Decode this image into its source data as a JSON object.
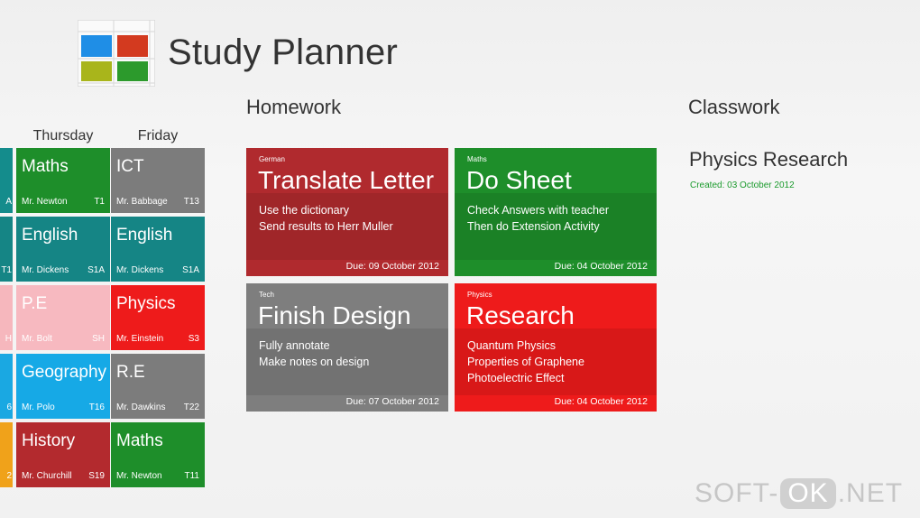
{
  "app": {
    "title": "Study Planner"
  },
  "logo": {
    "colors": [
      "#1f8ee6",
      "#d33a1f",
      "#a9b51b",
      "#2c9a2c"
    ]
  },
  "sections": {
    "homework": "Homework",
    "classwork": "Classwork"
  },
  "timetable": {
    "days": [
      "Thursday",
      "Friday"
    ],
    "partial_rooms": [
      "A",
      "T1",
      "H",
      "6",
      "2"
    ],
    "partial_colors": [
      "#148c8c",
      "#158585",
      "#f6b7bd",
      "#1aa8e2",
      "#f0a21a"
    ],
    "thursday": [
      {
        "subject": "Maths",
        "teacher": "Mr. Newton",
        "room": "T1",
        "color": "#1e8e2a"
      },
      {
        "subject": "English",
        "teacher": "Mr. Dickens",
        "room": "S1A",
        "color": "#158585"
      },
      {
        "subject": "P.E",
        "teacher": "Mr. Bolt",
        "room": "SH",
        "color": "#f7b9c0"
      },
      {
        "subject": "Geography",
        "teacher": "Mr. Polo",
        "room": "T16",
        "color": "#16a9e6"
      },
      {
        "subject": "History",
        "teacher": "Mr. Churchill",
        "room": "S19",
        "color": "#b32a2e"
      }
    ],
    "friday": [
      {
        "subject": "ICT",
        "teacher": "Mr. Babbage",
        "room": "T13",
        "color": "#7c7c7c"
      },
      {
        "subject": "English",
        "teacher": "Mr. Dickens",
        "room": "S1A",
        "color": "#158585"
      },
      {
        "subject": "Physics",
        "teacher": "Mr. Einstein",
        "room": "S3",
        "color": "#ee1b1b"
      },
      {
        "subject": "R.E",
        "teacher": "Mr. Dawkins",
        "room": "T22",
        "color": "#7c7c7c"
      },
      {
        "subject": "Maths",
        "teacher": "Mr. Newton",
        "room": "T11",
        "color": "#1e8e2a"
      }
    ]
  },
  "homework": [
    {
      "category": "German",
      "title": "Translate Letter",
      "lines": [
        "Use the dictionary",
        "Send results to Herr Muller"
      ],
      "due": "Due: 09 October 2012",
      "color": "#b02a2e"
    },
    {
      "category": "Maths",
      "title": "Do Sheet",
      "lines": [
        "Check Answers with teacher",
        "Then do Extension Activity"
      ],
      "due": "Due: 04 October 2012",
      "color": "#1e8e2a"
    },
    {
      "category": "Tech",
      "title": "Finish Design",
      "lines": [
        "Fully annotate",
        "Make notes on design"
      ],
      "due": "Due: 07 October 2012",
      "color": "#7e7e7e"
    },
    {
      "category": "Physics",
      "title": "Research",
      "lines": [
        "Quantum Physics",
        "Properties of Graphene",
        "Photoelectric Effect"
      ],
      "due": "Due: 04 October 2012",
      "color": "#ee1b1b"
    }
  ],
  "classwork": [
    {
      "title": "Physics Research",
      "created": "Created: 03 October 2012"
    }
  ],
  "watermark": {
    "left": "SOFT-",
    "ok": "OK",
    "right": ".NET"
  }
}
